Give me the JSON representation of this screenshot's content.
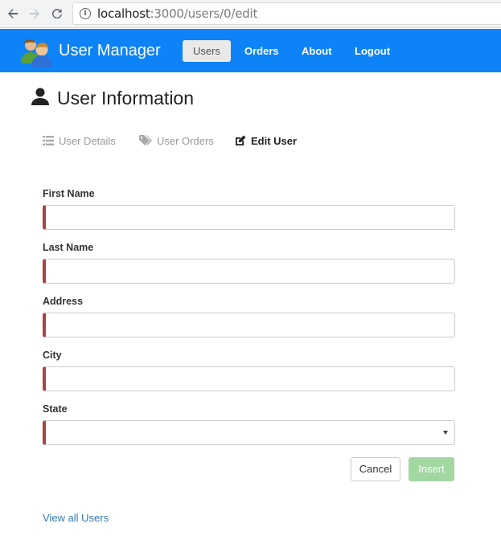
{
  "browser": {
    "url_host": "localhost",
    "url_rest": ":3000/users/0/edit"
  },
  "navbar": {
    "brand": "User Manager",
    "brand_color": "#0d83f7",
    "items": [
      {
        "label": "Users",
        "active": true
      },
      {
        "label": "Orders",
        "active": false
      },
      {
        "label": "About",
        "active": false
      },
      {
        "label": "Logout",
        "active": false
      }
    ]
  },
  "page": {
    "title": "User Information",
    "title_icon": "user-icon"
  },
  "tabs": [
    {
      "label": "User Details",
      "icon": "list-icon",
      "active": false
    },
    {
      "label": "User Orders",
      "icon": "tags-icon",
      "active": false
    },
    {
      "label": "Edit User",
      "icon": "edit-icon",
      "active": true
    }
  ],
  "form": {
    "fields": [
      {
        "label": "First Name",
        "value": ""
      },
      {
        "label": "Last Name",
        "value": ""
      },
      {
        "label": "Address",
        "value": ""
      },
      {
        "label": "City",
        "value": ""
      },
      {
        "label": "State",
        "value": ""
      }
    ],
    "invalid_color": "#a94442",
    "cancel_label": "Cancel",
    "insert_label": "Insert",
    "insert_enabled": false
  },
  "footer": {
    "view_all_label": "View all Users"
  }
}
